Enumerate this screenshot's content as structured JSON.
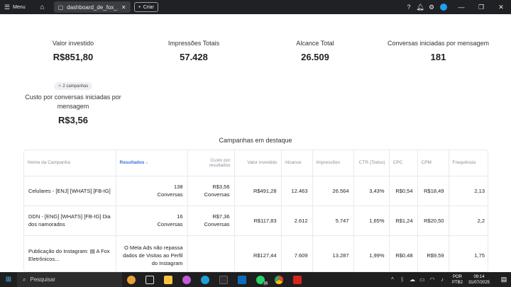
{
  "titlebar": {
    "menu_label": "Menu",
    "tab_label": "dashboard_de_fox_...",
    "new_tab_label": "Criar"
  },
  "metrics": {
    "invested": {
      "label": "Valor investido",
      "value": "R$851,80"
    },
    "impressions": {
      "label": "Impressões Totais",
      "value": "57.428"
    },
    "reach": {
      "label": "Alcance Total",
      "value": "26.509"
    },
    "conversations": {
      "label": "Conversas iniciadas por mensagem",
      "value": "181"
    },
    "cost_per": {
      "badge": "2 campanhas",
      "label": "Custo por conversas iniciadas por mensagem",
      "value": "R$3,56"
    }
  },
  "section_title": "Campanhas em destaque",
  "table": {
    "headers": {
      "name": "Nome da Campanha",
      "results": "Resultados",
      "cost": "Custo por resultados",
      "invested": "Valor investido",
      "reach": "Alcance",
      "impressions": "Impressões",
      "ctr": "CTR (Todos)",
      "cpc": "CPC",
      "cpm": "CPM",
      "frequency": "Frequência"
    },
    "rows": [
      {
        "name": "Celulares - [ENJ] [WHATS] [FB-IG]",
        "results": "138",
        "results_unit": "Conversas",
        "cost": "R$3,56",
        "cost_unit": "Conversas",
        "invested": "R$491,28",
        "reach": "12.463",
        "impressions": "26.564",
        "ctr": "3,43%",
        "cpc": "R$0,54",
        "cpm": "R$18,49",
        "frequency": "2,13"
      },
      {
        "name": "DDN - [ENG] [WHATS] [FB-IG] Dia dos namorados",
        "results": "16",
        "results_unit": "Conversas",
        "cost": "R$7,36",
        "cost_unit": "Conversas",
        "invested": "R$117,83",
        "reach": "2.612",
        "impressions": "5.747",
        "ctr": "1,65%",
        "cpc": "R$1,24",
        "cpm": "R$20,50",
        "frequency": "2,2"
      },
      {
        "name": "Publicação do Instagram: ▤ A Fox Eletrônicos...",
        "results": "O Meta Ads não repassa dados de Visitas ao Perfil do Instagram",
        "results_unit": "",
        "cost": "",
        "cost_unit": "",
        "invested": "R$127,44",
        "reach": "7.609",
        "impressions": "13.287",
        "ctr": "1,99%",
        "cpc": "R$0,48",
        "cpm": "R$9,59",
        "frequency": "1,75"
      }
    ]
  },
  "taskbar": {
    "search_placeholder": "Pesquisar",
    "lang_line1": "POR",
    "lang_line2": "PTB2",
    "time": "09:14",
    "date": "31/07/2025",
    "whatsapp_badge": "16"
  }
}
